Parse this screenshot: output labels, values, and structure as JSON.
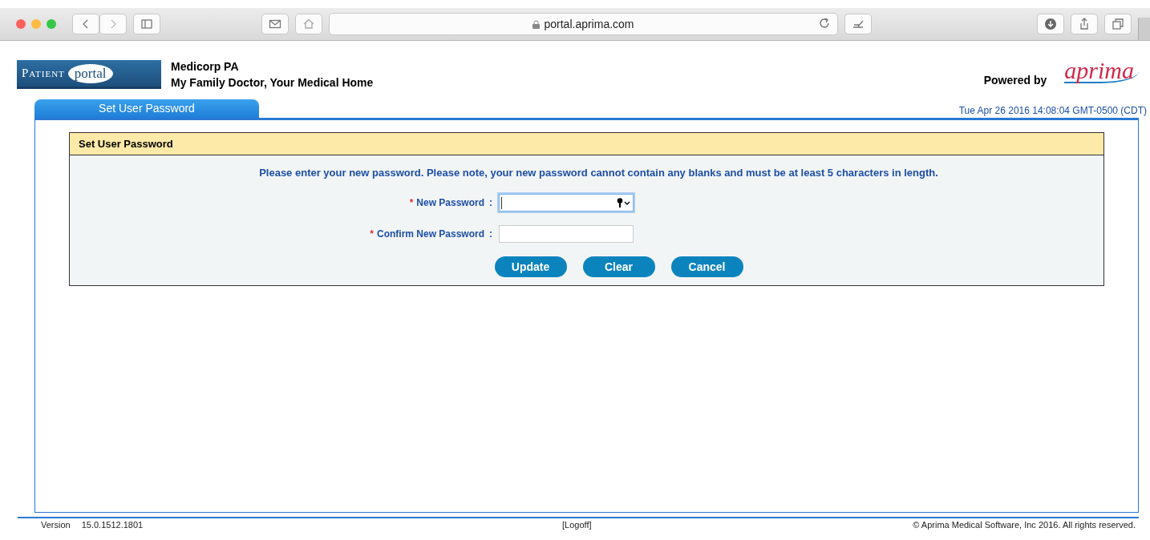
{
  "browser": {
    "url": "portal.aprima.com"
  },
  "header": {
    "logo_left": "Patient",
    "logo_right": "portal",
    "practice_name": "Medicorp PA",
    "tagline": "My Family Doctor, Your Medical Home",
    "powered_by": "Powered by",
    "brand_logo": "aprima"
  },
  "tabs": [
    {
      "label": "Set User Password",
      "selected": true
    }
  ],
  "timestamp": "Tue Apr 26 2016 14:08:04 GMT-0500 (CDT)",
  "form": {
    "title": "Set User Password",
    "instructions": "Please enter your new password. Please note, your new password cannot contain any blanks and must be at least 5 characters in length.",
    "fields": [
      {
        "label": "New Password",
        "required": true,
        "focused": true
      },
      {
        "label": "Confirm New Password",
        "required": true,
        "focused": false
      }
    ],
    "separator": ":",
    "required_mark": "*",
    "buttons": [
      "Update",
      "Clear",
      "Cancel"
    ]
  },
  "footer": {
    "version_label": "Version",
    "version": "15.0.1512.1801",
    "logoff": "[Logoff]",
    "copyright": "© Aprima Medical Software, Inc 2016. All rights reserved."
  }
}
